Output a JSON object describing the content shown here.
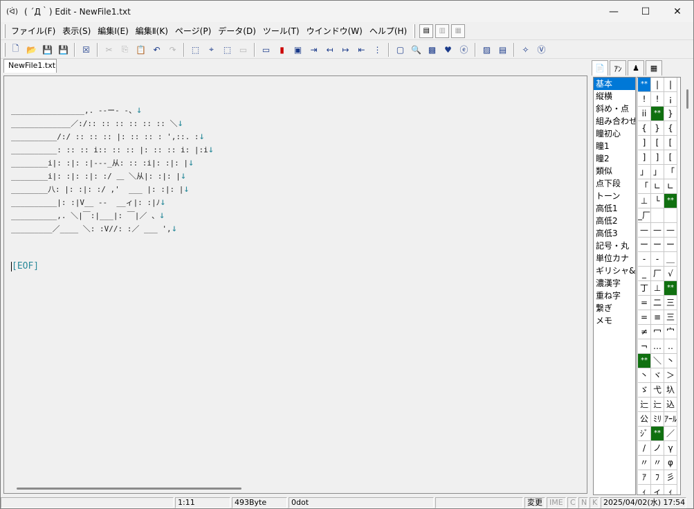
{
  "window": {
    "icon_text": "(ᐛ)",
    "title": "( ´Д｀) Edit - NewFile1.txt",
    "controls": {
      "minimize": "—",
      "maximize": "☐",
      "close": "✕"
    }
  },
  "menu": {
    "items": [
      "ファイル(F)",
      "表示(S)",
      "編集Ⅰ(E)",
      "編集Ⅱ(K)",
      "ページ(P)",
      "データ(D)",
      "ツール(T)",
      "ウインドウ(W)",
      "ヘルプ(H)"
    ]
  },
  "tab": {
    "label": "NewFile1.txt"
  },
  "editor": {
    "lines": [
      "________________,. -‐ー‐ -、",
      "_____________／:/:: :: :: :: :: :: ＼",
      "__________/:/ :: :: :: |: :: :: : ',::. :",
      "__________: :: :: i:: :: :: |: :: :: i: |:i",
      "________i|: :|: :|--‐_从: :: :i|: :|: |",
      "________i|: :|: :|: :/ ＿ ＼从|: :|: |",
      "________八: |: :|: :/ ,'  ___ |: :|: |",
      "__________|: :|V__ --  __ィ|: :|ﾉ",
      "__________,. ＼|￣:|___|: ￣|／ 、",
      "_________／____ ＼: :V//: :／ ___ ',"
    ],
    "arrow": "↓",
    "eof": "[EOF]"
  },
  "palette": {
    "tabs": [
      "📄",
      "ｱﾝ",
      "♟",
      "▦"
    ],
    "categories": [
      "基本",
      "縦横",
      "斜め・点",
      "組み合わせ",
      "瞳初心",
      "瞳1",
      "瞳2",
      "類似",
      "点下段",
      "トーン",
      "高低1",
      "高低2",
      "高低3",
      "記号・丸",
      "単位カナ",
      "ギリシャ&",
      "濃漢字",
      "重ね字",
      "繋ぎ",
      "メモ"
    ],
    "selected_category": "基本",
    "cells": [
      "**",
      "|",
      "|",
      "!",
      "!",
      "¡",
      "ii",
      "**",
      "}",
      "{",
      "}",
      "{",
      "]",
      "[",
      "[",
      "]",
      "]",
      "[",
      "」",
      "」",
      "「",
      "「",
      "∟",
      "∟",
      "⊥",
      "└",
      "**",
      "_厂",
      "",
      "",
      "—",
      "—",
      "—",
      "ー",
      "ー",
      "ー",
      "-",
      "-",
      "＿",
      "_",
      "厂",
      "√",
      "丁",
      "⊥",
      "**",
      "=",
      "二",
      "三",
      "=",
      "≡",
      "三",
      "≠",
      "冖",
      "宀",
      "¬",
      "…",
      "‥",
      "**",
      "＼",
      "丶",
      "丶",
      "ヾ",
      "＞",
      "ゞ",
      "弋",
      "圦",
      "辷",
      "辷",
      "込",
      "公",
      "ﾐﾘ",
      "ｱｰﾙ",
      "ｼﾞ",
      "**",
      "／",
      "/",
      "ノ",
      "γ",
      "〃",
      "〃",
      "φ",
      "ｱ",
      "ﾌ",
      "彡",
      "ｨ",
      "ィ",
      "ｨ"
    ],
    "green_cells": [
      7,
      26,
      44,
      57,
      73
    ],
    "blue_cells": [
      0
    ]
  },
  "statusbar": {
    "cursor": "1:11",
    "size": "493Byte",
    "dots": "0dot",
    "modified": "変更",
    "ime": "IME",
    "c": "C",
    "n": "N",
    "k": "K",
    "datetime": "2025/04/02(水) 17:54"
  }
}
